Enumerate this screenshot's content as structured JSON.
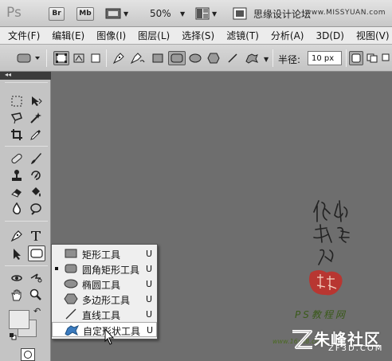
{
  "app": {
    "logo": "Ps"
  },
  "topbar": {
    "bridge_label": "Br",
    "minibridge_label": "Mb",
    "zoom": "50%",
    "workspace_title": "思缘设计论坛",
    "workspace_url": "www.MISSYUAN.com"
  },
  "menubar": {
    "items": [
      "文件(F)",
      "编辑(E)",
      "图像(I)",
      "图层(L)",
      "选择(S)",
      "滤镜(T)",
      "分析(A)",
      "3D(D)",
      "视图(V)"
    ]
  },
  "options": {
    "radius_label": "半径:",
    "radius_value": "10 px"
  },
  "toolbox": {
    "collapse": "◂◂"
  },
  "flyout": {
    "items": [
      {
        "label": "矩形工具",
        "key": "U",
        "icon": "rectangle-shape-icon",
        "current": false,
        "hovered": false
      },
      {
        "label": "圆角矩形工具",
        "key": "U",
        "icon": "rounded-rectangle-icon",
        "current": true,
        "hovered": false
      },
      {
        "label": "椭圆工具",
        "key": "U",
        "icon": "ellipse-icon",
        "current": false,
        "hovered": false
      },
      {
        "label": "多边形工具",
        "key": "U",
        "icon": "polygon-icon",
        "current": false,
        "hovered": false
      },
      {
        "label": "直线工具",
        "key": "U",
        "icon": "line-icon",
        "current": false,
        "hovered": false
      },
      {
        "label": "自定形状工具",
        "key": "U",
        "icon": "custom-shape-icon",
        "current": false,
        "hovered": true
      }
    ]
  },
  "watermarks": {
    "psjc": "PS教程网",
    "psjc_url": "www.16xx8.com",
    "zf3d_text": "朱峰社区",
    "zf3d_url": "ZF3D.COM"
  },
  "colors": {
    "canvas_bg": "#6e6e6e",
    "panel_bg": "#c4c4c4",
    "menubar_bg": "#ececec",
    "flyout_bg": "#efefef",
    "seal_red": "#c0302a"
  }
}
